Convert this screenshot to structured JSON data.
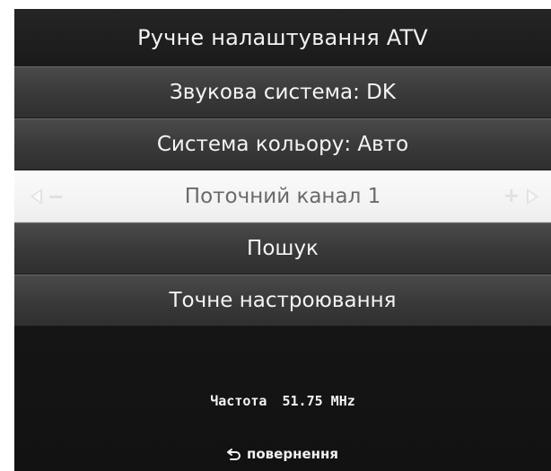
{
  "title": "Ручне налаштування ATV",
  "menu": {
    "sound_system": "Звукова система: DK",
    "color_system": "Система кольору: Авто",
    "current_channel": "Поточний канал 1",
    "search": "Пошук",
    "fine_tuning": "Точне настроювання"
  },
  "info": {
    "frequency_label": "Частота",
    "frequency_value": "51.75 MHz"
  },
  "footer": {
    "back_label": "повернення",
    "back_icon": "return-arrow-icon"
  },
  "colors": {
    "background": "#141414",
    "row": "#3a3a3a",
    "selected_row": "#f4f4f4",
    "text": "#f4f4f4",
    "selected_text": "#6a6a6a"
  }
}
